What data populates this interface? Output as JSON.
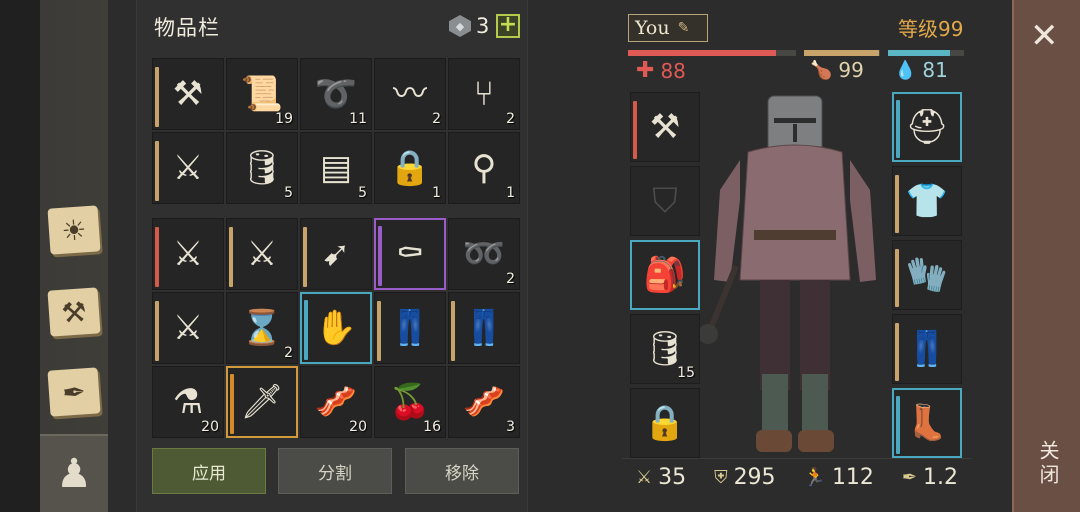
{
  "inventory": {
    "title": "物品栏",
    "gem_count": "3",
    "plus_label": "+",
    "grid_top": [
      {
        "icon": "mace-icon",
        "glyph": "⚒",
        "count": "",
        "dur": "#c9a46a"
      },
      {
        "icon": "leather-scroll-icon",
        "glyph": "📜",
        "count": "19",
        "dur": ""
      },
      {
        "icon": "rope-coil-icon",
        "glyph": "➰",
        "count": "11",
        "dur": ""
      },
      {
        "icon": "fiber-icon",
        "glyph": "〰",
        "count": "2",
        "dur": ""
      },
      {
        "icon": "fork-icon",
        "glyph": "⑂",
        "count": "2",
        "dur": ""
      },
      {
        "icon": "sword-icon",
        "glyph": "⚔",
        "count": "",
        "dur": "#c9a46a"
      },
      {
        "icon": "barrel-icon",
        "glyph": "🛢",
        "count": "5",
        "dur": ""
      },
      {
        "icon": "cloth-icon",
        "glyph": "▤",
        "count": "5",
        "dur": ""
      },
      {
        "icon": "padlock-icon",
        "glyph": "🔒",
        "count": "1",
        "dur": ""
      },
      {
        "icon": "spoon-icon",
        "glyph": "⚲",
        "count": "1",
        "dur": ""
      }
    ],
    "grid_bottom": [
      {
        "icon": "wooden-sword-icon",
        "glyph": "⚔",
        "count": "",
        "dur": "#d45a4a",
        "sel": ""
      },
      {
        "icon": "wooden-sword-icon",
        "glyph": "⚔",
        "count": "",
        "dur": "#c9a46a",
        "sel": ""
      },
      {
        "icon": "crossbow-icon",
        "glyph": "➹",
        "count": "",
        "dur": "#c9a46a",
        "sel": ""
      },
      {
        "icon": "scythe-icon",
        "glyph": "⚰",
        "count": "",
        "dur": "#9a5cc8",
        "sel": "purple"
      },
      {
        "icon": "rope-icon",
        "glyph": "➿",
        "count": "2",
        "dur": "",
        "sel": ""
      },
      {
        "icon": "sword-icon",
        "glyph": "⚔",
        "count": "",
        "dur": "#c9a46a",
        "sel": ""
      },
      {
        "icon": "hourglass-icon",
        "glyph": "⌛",
        "count": "2",
        "dur": "",
        "sel": ""
      },
      {
        "icon": "gauntlets-icon",
        "glyph": "✋",
        "count": "",
        "dur": "#4aa8c0",
        "sel": "cyan"
      },
      {
        "icon": "pants-icon",
        "glyph": "👖",
        "count": "",
        "dur": "#c9a46a",
        "sel": ""
      },
      {
        "icon": "pants-icon",
        "glyph": "👖",
        "count": "",
        "dur": "#c9a46a",
        "sel": ""
      },
      {
        "icon": "potion-icon",
        "glyph": "⚗",
        "count": "20",
        "dur": "",
        "sel": ""
      },
      {
        "icon": "dagger-icon",
        "glyph": "🗡",
        "count": "",
        "dur": "#d38a2a",
        "sel": "orange"
      },
      {
        "icon": "meat-icon",
        "glyph": "🥓",
        "count": "20",
        "dur": "",
        "sel": ""
      },
      {
        "icon": "berry-bucket-icon",
        "glyph": "🍒",
        "count": "16",
        "dur": "",
        "sel": ""
      },
      {
        "icon": "meat-icon",
        "glyph": "🥓",
        "count": "3",
        "dur": "",
        "sel": ""
      }
    ],
    "buttons": {
      "apply": "应用",
      "split": "分割",
      "remove": "移除"
    }
  },
  "hero": {
    "name": "You",
    "level": "等级99",
    "health": "88",
    "hunger": "99",
    "water": "81",
    "health_pct": 0.88,
    "hunger_pct": 0.99,
    "water_pct": 0.81
  },
  "equipment": {
    "left": [
      {
        "icon": "mace-icon",
        "glyph": "⚒",
        "count": "",
        "ghost": false,
        "cyan": false,
        "dur": "#d45a4a"
      },
      {
        "icon": "shield-icon",
        "glyph": "⛉",
        "count": "",
        "ghost": true,
        "cyan": false,
        "dur": ""
      },
      {
        "icon": "backpack-icon",
        "glyph": "🎒",
        "count": "",
        "ghost": false,
        "cyan": true,
        "dur": ""
      },
      {
        "icon": "barrel-icon",
        "glyph": "🛢",
        "count": "15",
        "ghost": false,
        "cyan": false,
        "dur": ""
      },
      {
        "icon": "lock-icon",
        "glyph": "🔒",
        "count": "",
        "ghost": true,
        "cyan": false,
        "dur": ""
      }
    ],
    "right": [
      {
        "icon": "helmet-icon",
        "glyph": "⛑",
        "count": "",
        "ghost": false,
        "cyan": true,
        "dur": "#4aa8c0"
      },
      {
        "icon": "chainmail-icon",
        "glyph": "👕",
        "count": "",
        "ghost": false,
        "cyan": false,
        "dur": "#c9a46a"
      },
      {
        "icon": "gloves-icon",
        "glyph": "🧤",
        "count": "",
        "ghost": false,
        "cyan": false,
        "dur": "#c9a46a"
      },
      {
        "icon": "pants-icon",
        "glyph": "👖",
        "count": "",
        "ghost": false,
        "cyan": false,
        "dur": "#c9a46a"
      },
      {
        "icon": "boots-icon",
        "glyph": "👢",
        "count": "",
        "ghost": false,
        "cyan": true,
        "dur": "#4aa8c0"
      }
    ]
  },
  "stats": {
    "attack": "35",
    "armor": "295",
    "speed": "112",
    "weight": "1.2"
  },
  "close": {
    "x": "✕",
    "label": "关闭"
  },
  "colors": {
    "health": "#e05a55",
    "hunger": "#c9a46a",
    "water": "#5ab6c4",
    "level": "#e1a84a"
  }
}
